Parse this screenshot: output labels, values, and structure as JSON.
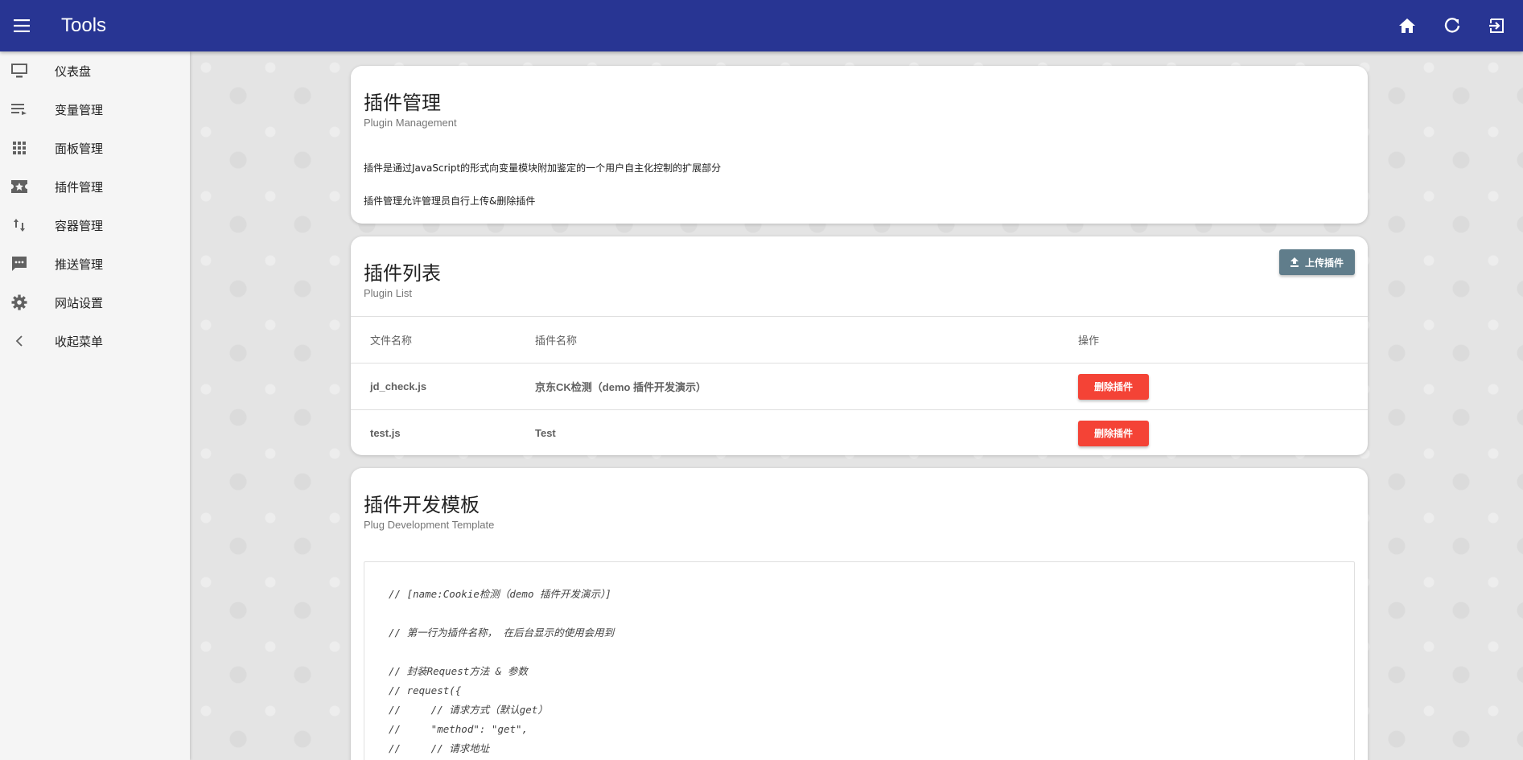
{
  "header": {
    "app_title": "Tools",
    "menu_icon": "menu-icon",
    "actions": [
      "home-icon",
      "refresh-icon",
      "logout-icon"
    ]
  },
  "sidebar": {
    "items": [
      {
        "label": "仪表盘",
        "icon": "monitor-icon"
      },
      {
        "label": "变量管理",
        "icon": "list-icon"
      },
      {
        "label": "面板管理",
        "icon": "grid-icon"
      },
      {
        "label": "插件管理",
        "icon": "star-ticket-icon"
      },
      {
        "label": "容器管理",
        "icon": "swap-vertical-icon"
      },
      {
        "label": "推送管理",
        "icon": "chat-icon"
      },
      {
        "label": "网站设置",
        "icon": "gear-icon"
      },
      {
        "label": "收起菜单",
        "icon": "chevron-left-icon"
      }
    ]
  },
  "plugin_management": {
    "title": "插件管理",
    "subtitle": "Plugin Management",
    "line1": "插件是通过JavaScript的形式向变量模块附加鉴定的一个用户自主化控制的扩展部分",
    "line2": "插件管理允许管理员自行上传&删除插件"
  },
  "plugin_list": {
    "title": "插件列表",
    "subtitle": "Plugin List",
    "upload_label": "上传插件",
    "columns": [
      "文件名称",
      "插件名称",
      "操作"
    ],
    "rows": [
      {
        "file": "jd_check.js",
        "name": "京东CK检测（demo 插件开发演示）",
        "action": "删除插件"
      },
      {
        "file": "test.js",
        "name": "Test",
        "action": "删除插件"
      }
    ]
  },
  "template": {
    "title": "插件开发模板",
    "subtitle": "Plug Development Template",
    "code_lines": [
      "// [name:Cookie检测（demo 插件开发演示）]",
      "",
      "// 第一行为插件名称， 在后台显示的使用会用到",
      "",
      "// 封装Request方法 & 参数",
      "// request({",
      "//     // 请求方式（默认get）",
      "//     \"method\": \"get\",",
      "//     // 请求地址"
    ]
  },
  "colors": {
    "header_bg": "#283593",
    "delete_button": "#f44336",
    "upload_button": "#607d8b"
  }
}
